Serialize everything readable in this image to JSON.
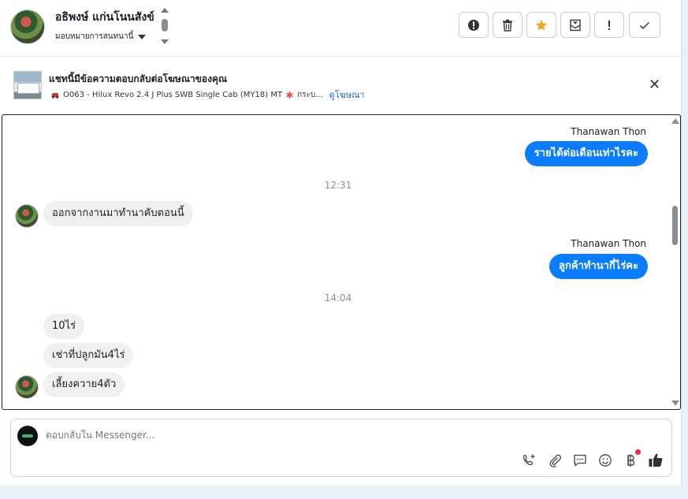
{
  "header": {
    "user_name": "อธิพงษ์ แก่นโนนสังข์",
    "assign_label": "มอบหมายการสนทนานี้",
    "actions": [
      "alert-circle",
      "trash",
      "star",
      "mark-unread",
      "spam",
      "done"
    ],
    "colors": {
      "star": "#f5a623"
    }
  },
  "ad": {
    "title": "แชทนี้มีข้อความตอบกลับต่อโฆษณาของคุณ",
    "subtitle": "O063 - Hilux Revo 2.4 J Plus SWB Single Cab (MY18) MT",
    "extra": "กระบ...",
    "link": "ดูโฆษณา",
    "close": "✕"
  },
  "conversation": {
    "messages": [
      {
        "type": "outgoing",
        "sender": "Thanawan Thon",
        "text": "รายได้ต่อเดือนเท่าไรคะ"
      },
      {
        "type": "timestamp",
        "text": "12:31"
      },
      {
        "type": "incoming",
        "text": "ออกจากงานมาทำนาคับตอนนี้"
      },
      {
        "type": "outgoing",
        "sender": "Thanawan Thon",
        "text": "ลูกค้าทำนากี่ไร่คะ"
      },
      {
        "type": "timestamp",
        "text": "14:04"
      },
      {
        "type": "incoming",
        "text": "10ไร่"
      },
      {
        "type": "incoming",
        "text": "เช่าที่ปลูกมัน4ไร่"
      },
      {
        "type": "incoming",
        "text": "เลี้ยงควาย4ตัว"
      }
    ],
    "colors": {
      "outgoing": "#0a7cff",
      "incoming": "#f0f0f0"
    }
  },
  "composer": {
    "placeholder": "ตอบกลับใน Messenger...",
    "tools": [
      "phone-plus",
      "paperclip",
      "message-square",
      "smiley",
      "baht",
      "thumbs-up"
    ]
  }
}
